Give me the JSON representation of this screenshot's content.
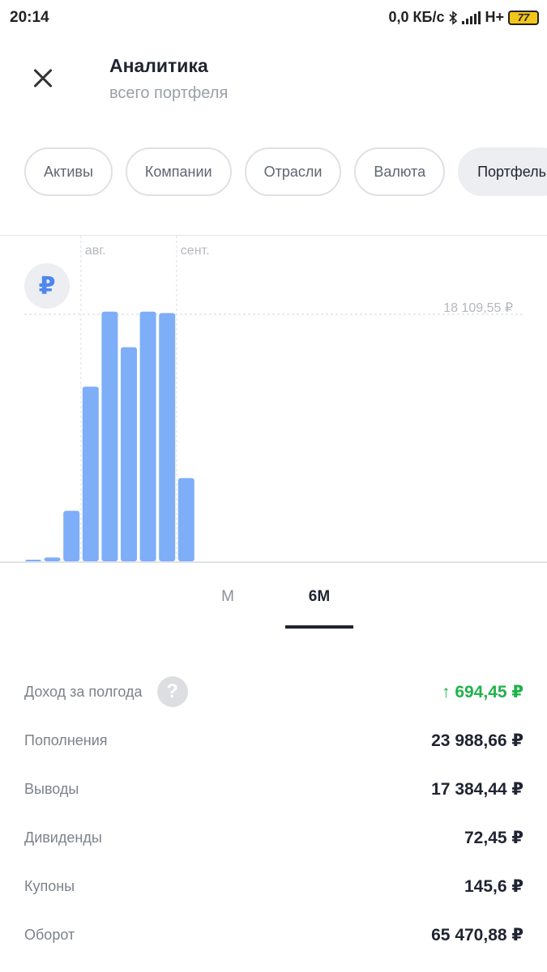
{
  "status_bar": {
    "time": "20:14",
    "network_speed": "0,0 КБ/с",
    "network_type": "H+",
    "battery": "77",
    "icons": [
      "bluetooth-icon",
      "signal-icon",
      "battery-icon"
    ]
  },
  "header": {
    "close_icon": "close-icon",
    "title": "Аналитика",
    "subtitle": "всего портфеля"
  },
  "chips": [
    "Активы",
    "Компании",
    "Отрасли",
    "Валюта",
    "Портфель"
  ],
  "chart": {
    "currency_symbol": "₽",
    "month_labels": [
      "авг.",
      "сент."
    ],
    "max_label": "18 109,55 ₽",
    "bar_color": "#7eaef8"
  },
  "chart_data": {
    "type": "bar",
    "categories": [
      "1",
      "2",
      "3",
      "4",
      "5",
      "6",
      "7",
      "8",
      "9"
    ],
    "values": [
      20,
      280,
      3700,
      12800,
      18300,
      15700,
      18300,
      18200,
      6100
    ],
    "month_markers": [
      {
        "label": "авг.",
        "after_category": "4"
      },
      {
        "label": "сент.",
        "after_category": "9"
      }
    ],
    "reference_line": {
      "value": 18109.55,
      "label": "18 109,55 ₽"
    },
    "ylim": [
      0,
      18109.55
    ]
  },
  "period_tabs": {
    "items": [
      "М",
      "6М"
    ],
    "active": "6М"
  },
  "stats": [
    {
      "label": "Доход за полгода",
      "value": "↑ 694,45 ₽",
      "positive": true,
      "help": true
    },
    {
      "label": "Пополнения",
      "value": "23 988,66 ₽"
    },
    {
      "label": "Выводы",
      "value": "17 384,44 ₽"
    },
    {
      "label": "Дивиденды",
      "value": "72,45 ₽"
    },
    {
      "label": "Купоны",
      "value": "145,6 ₽"
    },
    {
      "label": "Оборот",
      "value": "65 470,88 ₽"
    }
  ],
  "colors": {
    "accent": "#4f86f0",
    "positive": "#21b24b",
    "text_primary": "#1f2431",
    "text_secondary": "#7c828b"
  }
}
